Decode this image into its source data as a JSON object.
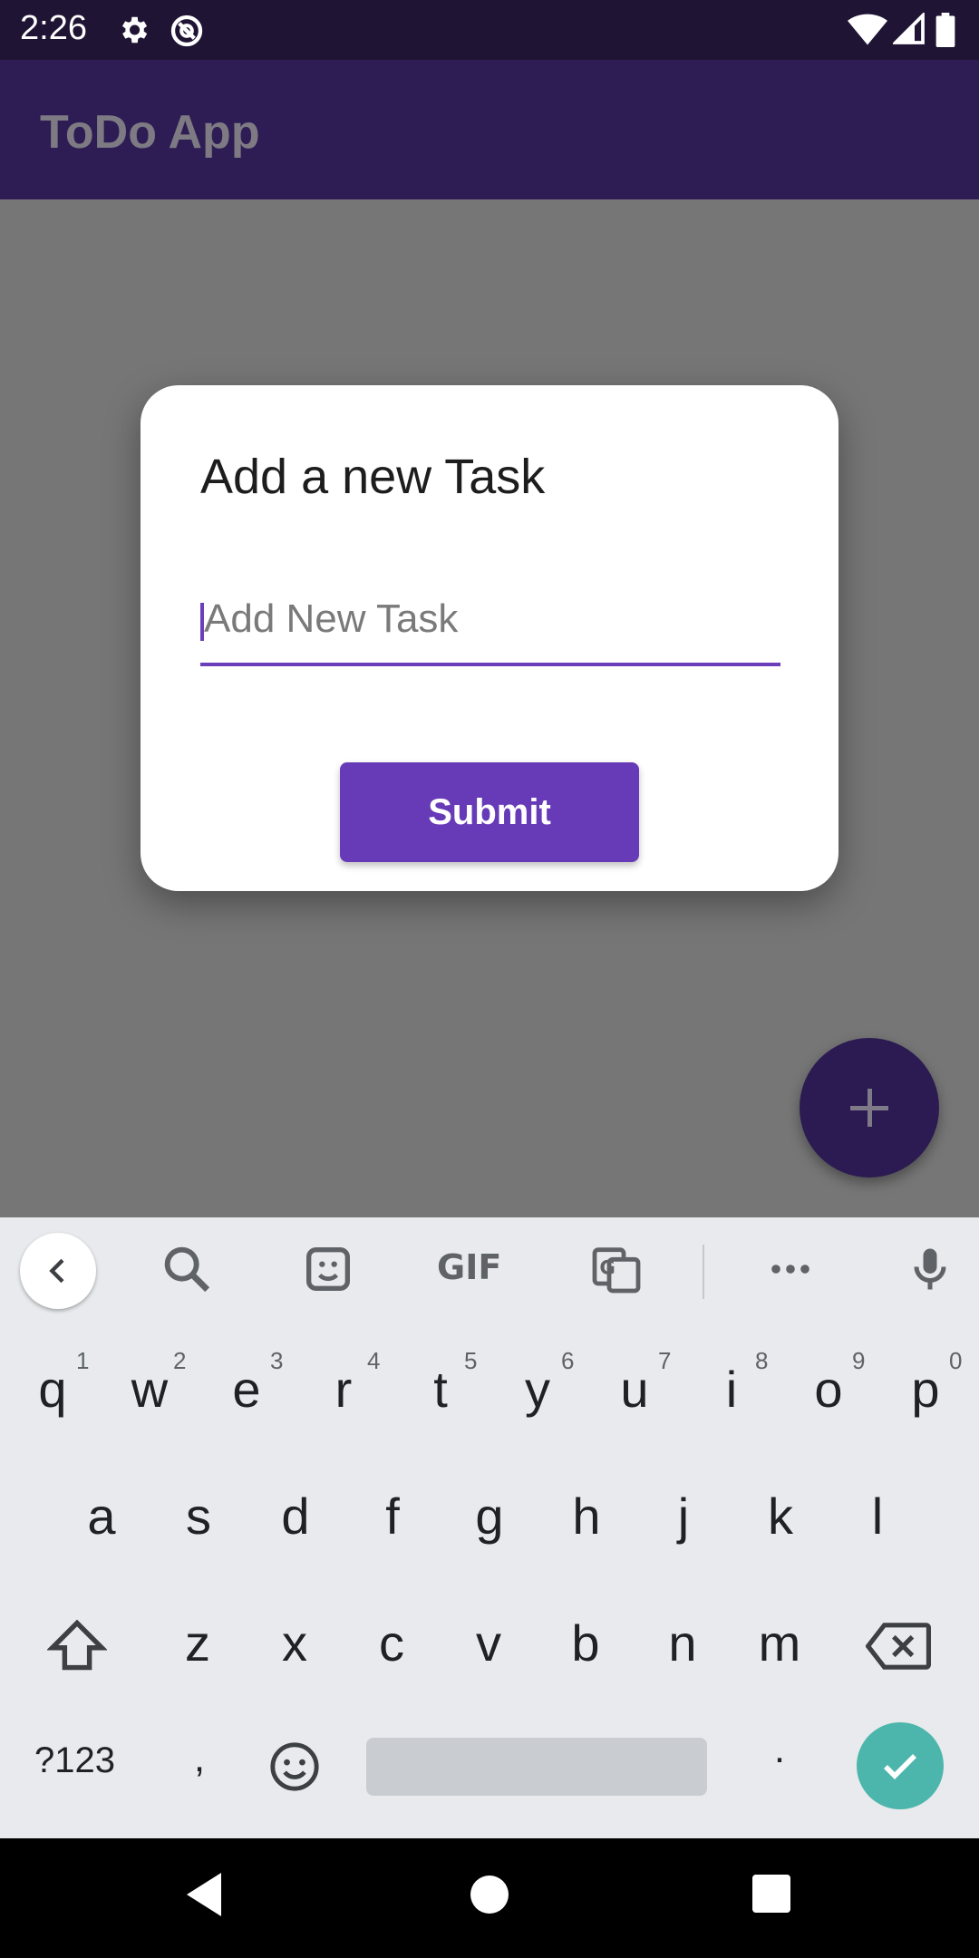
{
  "status_bar": {
    "time": "2:26",
    "icons": [
      "settings-icon",
      "data-saver-icon",
      "wifi-icon",
      "signal-icon",
      "battery-icon"
    ]
  },
  "app_bar": {
    "title": "ToDo App"
  },
  "dialog": {
    "title": "Add a new Task",
    "input_placeholder": "Add New Task",
    "input_value": "",
    "submit_label": "Submit"
  },
  "fab": {
    "icon": "plus-icon"
  },
  "keyboard": {
    "toolbar": [
      "back-icon",
      "search-icon",
      "sticker-icon",
      "GIF",
      "translate-icon",
      "more-icon",
      "mic-icon"
    ],
    "gif_label": "GIF",
    "row1": [
      "q",
      "w",
      "e",
      "r",
      "t",
      "y",
      "u",
      "i",
      "o",
      "p"
    ],
    "row1_hints": [
      "1",
      "2",
      "3",
      "4",
      "5",
      "6",
      "7",
      "8",
      "9",
      "0"
    ],
    "row2": [
      "a",
      "s",
      "d",
      "f",
      "g",
      "h",
      "j",
      "k",
      "l"
    ],
    "row3": [
      "z",
      "x",
      "c",
      "v",
      "b",
      "n",
      "m"
    ],
    "symbols_label": "?123",
    "comma": ",",
    "period": "."
  },
  "colors": {
    "accent": "#673ab7",
    "status_bar": "#201434",
    "app_bar_dimmed": "#2e1c54",
    "scrim": "#767676",
    "keyboard_bg": "#e8eaed",
    "enter_key": "#4db6ac"
  }
}
